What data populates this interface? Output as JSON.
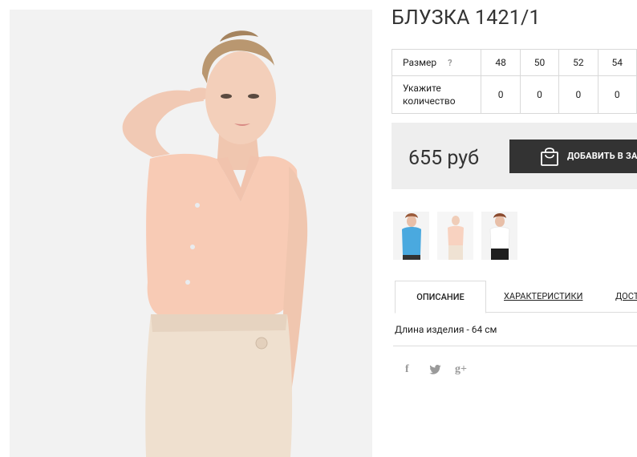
{
  "product": {
    "title": "БЛУЗКА 1421/1",
    "image_alt": "model wearing peach sleeveless blouse and cream skirt"
  },
  "size_table": {
    "size_label": "Размер",
    "help_glyph": "?",
    "qty_label_line1": "Укажите",
    "qty_label_line2": "количество",
    "sizes": [
      "48",
      "50",
      "52",
      "54"
    ],
    "quantities": [
      "0",
      "0",
      "0",
      "0"
    ]
  },
  "price": {
    "text": "655 руб",
    "add_to_cart_label": "ДОБАВИТЬ В ЗАКАЗ",
    "cart_icon": "shopping-bag-icon"
  },
  "thumbnails": [
    {
      "name": "blue-blouse-thumbnail"
    },
    {
      "name": "peach-blouse-thumbnail"
    },
    {
      "name": "white-blouse-thumbnail"
    }
  ],
  "tabs": {
    "description": "ОПИСАНИЕ",
    "characteristics": "ХАРАКТЕРИСТИКИ",
    "delivery": "ДОСТАВКА"
  },
  "description_text": "Длина изделия - 64 см",
  "social": {
    "facebook": "f",
    "twitter_icon": "twitter-icon",
    "google_plus": "g+"
  },
  "colors": {
    "button_bg": "#333333",
    "price_box_bg": "#eeeeee",
    "blouse": "#f8cbb5",
    "skirt": "#efe0cf"
  }
}
